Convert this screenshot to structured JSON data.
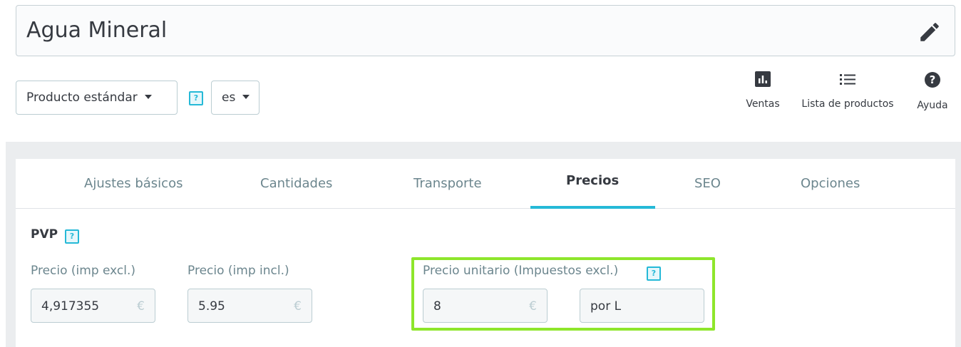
{
  "product": {
    "name": "Agua Mineral"
  },
  "controls": {
    "product_type": "Producto estándar",
    "language": "es",
    "help": "?"
  },
  "toolbar": {
    "sales": "Ventas",
    "product_list": "Lista de productos",
    "help": "Ayuda"
  },
  "tabs": [
    {
      "label": "Ajustes básicos"
    },
    {
      "label": "Cantidades"
    },
    {
      "label": "Transporte"
    },
    {
      "label": "Precios"
    },
    {
      "label": "SEO"
    },
    {
      "label": "Opciones"
    }
  ],
  "pricing": {
    "section_title": "PVP",
    "price_excl_label": "Precio (imp excl.)",
    "price_excl_value": "4,917355",
    "price_incl_label": "Precio (imp incl.)",
    "price_incl_value": "5.95",
    "unit_price_label": "Precio unitario (Impuestos excl.)",
    "unit_price_value": "8",
    "unit_value": "por L",
    "currency": "€"
  },
  "colors": {
    "accent": "#25b9d7",
    "highlight": "#8ee62b"
  }
}
